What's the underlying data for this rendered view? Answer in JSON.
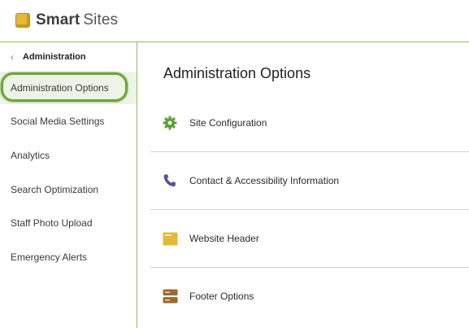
{
  "app": {
    "logo_bold": "Smart",
    "logo_light": "Sites"
  },
  "sidebar": {
    "back_label": "Administration",
    "items": [
      {
        "label": "Administration Options",
        "active": true
      },
      {
        "label": "Social Media Settings"
      },
      {
        "label": "Analytics"
      },
      {
        "label": "Search Optimization"
      },
      {
        "label": "Staff Photo Upload"
      },
      {
        "label": "Emergency Alerts"
      }
    ]
  },
  "main": {
    "title": "Administration Options",
    "options": [
      {
        "label": "Site Configuration",
        "icon": "gear-icon",
        "color": "#5aa03a"
      },
      {
        "label": "Contact & Accessibility Information",
        "icon": "phone-icon",
        "color": "#5b4ea1"
      },
      {
        "label": "Website Header",
        "icon": "header-window-icon",
        "color": "#e3b83a"
      },
      {
        "label": "Footer Options",
        "icon": "footer-icon",
        "color": "#9a6a35"
      }
    ]
  },
  "colors": {
    "accent": "#6fa43a",
    "active_bg": "#edf3e6",
    "divider": "#8fbf5a"
  }
}
